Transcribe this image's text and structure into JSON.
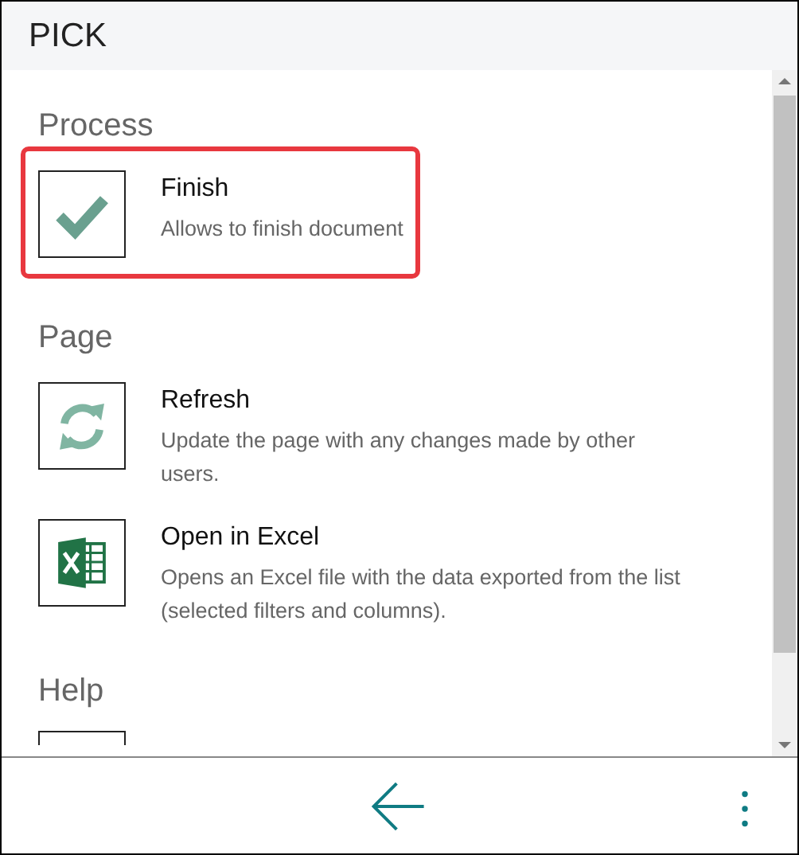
{
  "header": {
    "title": "PICK"
  },
  "sections": [
    {
      "heading": "Process",
      "items": [
        {
          "kind": "check",
          "title": "Finish",
          "description": "Allows to finish document",
          "selected": true
        }
      ]
    },
    {
      "heading": "Page",
      "items": [
        {
          "kind": "refresh",
          "title": "Refresh",
          "description": "Update the page with any changes made by other users.",
          "selected": false
        },
        {
          "kind": "excel",
          "title": "Open in Excel",
          "description": "Opens an Excel file with the data exported from the list (selected filters and columns).",
          "selected": false
        }
      ]
    },
    {
      "heading": "Help",
      "items": [
        {
          "kind": "blank",
          "selected": false
        }
      ]
    }
  ]
}
